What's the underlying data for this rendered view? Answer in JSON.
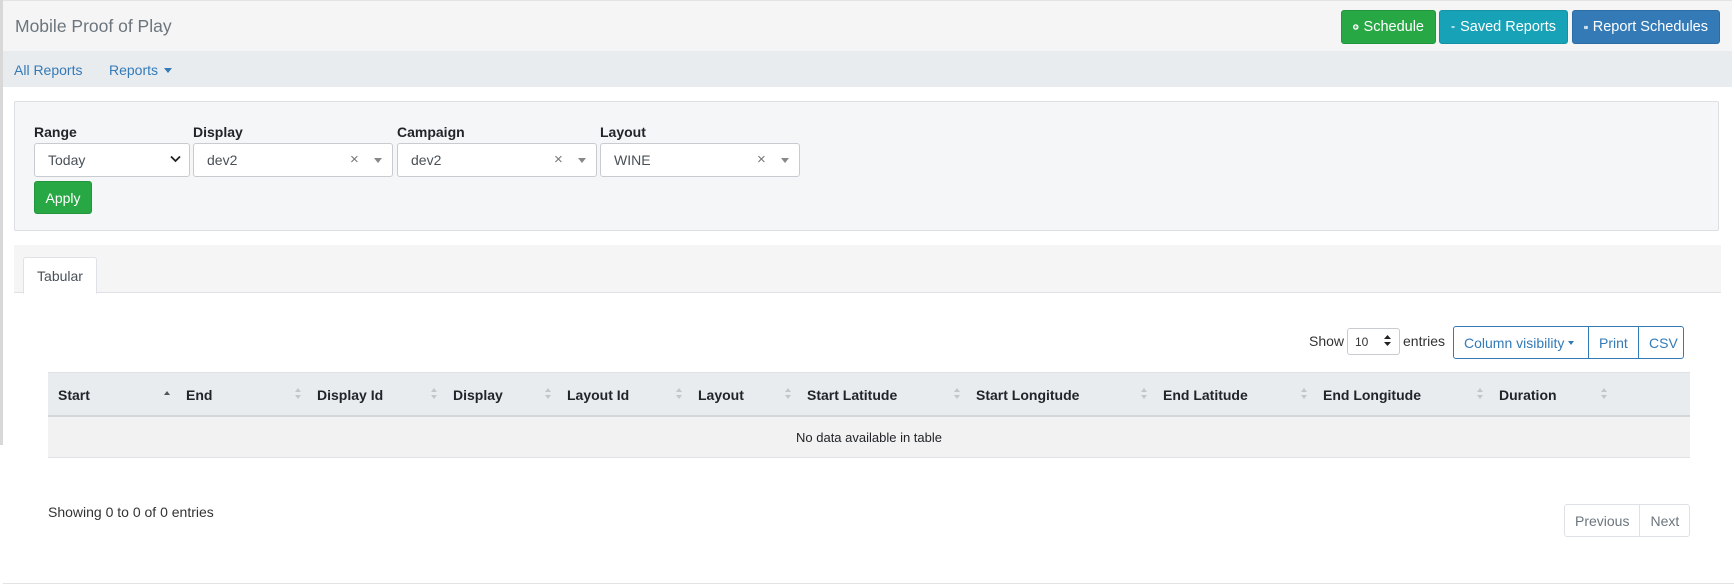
{
  "header": {
    "title": "Mobile Proof of Play",
    "schedule_label": "Schedule",
    "saved_reports_label": "Saved Reports",
    "report_schedules_label": "Report Schedules"
  },
  "nav": {
    "all_reports": "All Reports",
    "reports": "Reports"
  },
  "filters": {
    "range_label": "Range",
    "range_value": "Today",
    "display_label": "Display",
    "display_value": "dev2",
    "campaign_label": "Campaign",
    "campaign_value": "dev2",
    "layout_label": "Layout",
    "layout_value": "WINE",
    "clear_glyph": "×",
    "apply_label": "Apply"
  },
  "tabs": [
    {
      "label": "Tabular"
    }
  ],
  "table_controls": {
    "show_label": "Show",
    "page_length": "10",
    "entries_label": "entries",
    "column_visibility": "Column visibility",
    "print": "Print",
    "csv": "CSV"
  },
  "table": {
    "columns": [
      {
        "label": "Start",
        "sorted": "asc"
      },
      {
        "label": "End"
      },
      {
        "label": "Display Id"
      },
      {
        "label": "Display"
      },
      {
        "label": "Layout Id"
      },
      {
        "label": "Layout"
      },
      {
        "label": "Start Latitude"
      },
      {
        "label": "Start Longitude"
      },
      {
        "label": "End Latitude"
      },
      {
        "label": "End Longitude"
      },
      {
        "label": "Duration"
      }
    ],
    "empty_message": "No data available in table"
  },
  "footer": {
    "info": "Showing 0 to 0 of 0 entries",
    "previous": "Previous",
    "next": "Next"
  },
  "colors": {
    "success": "#28a745",
    "info": "#17a2b8",
    "primary": "#337ab7"
  }
}
